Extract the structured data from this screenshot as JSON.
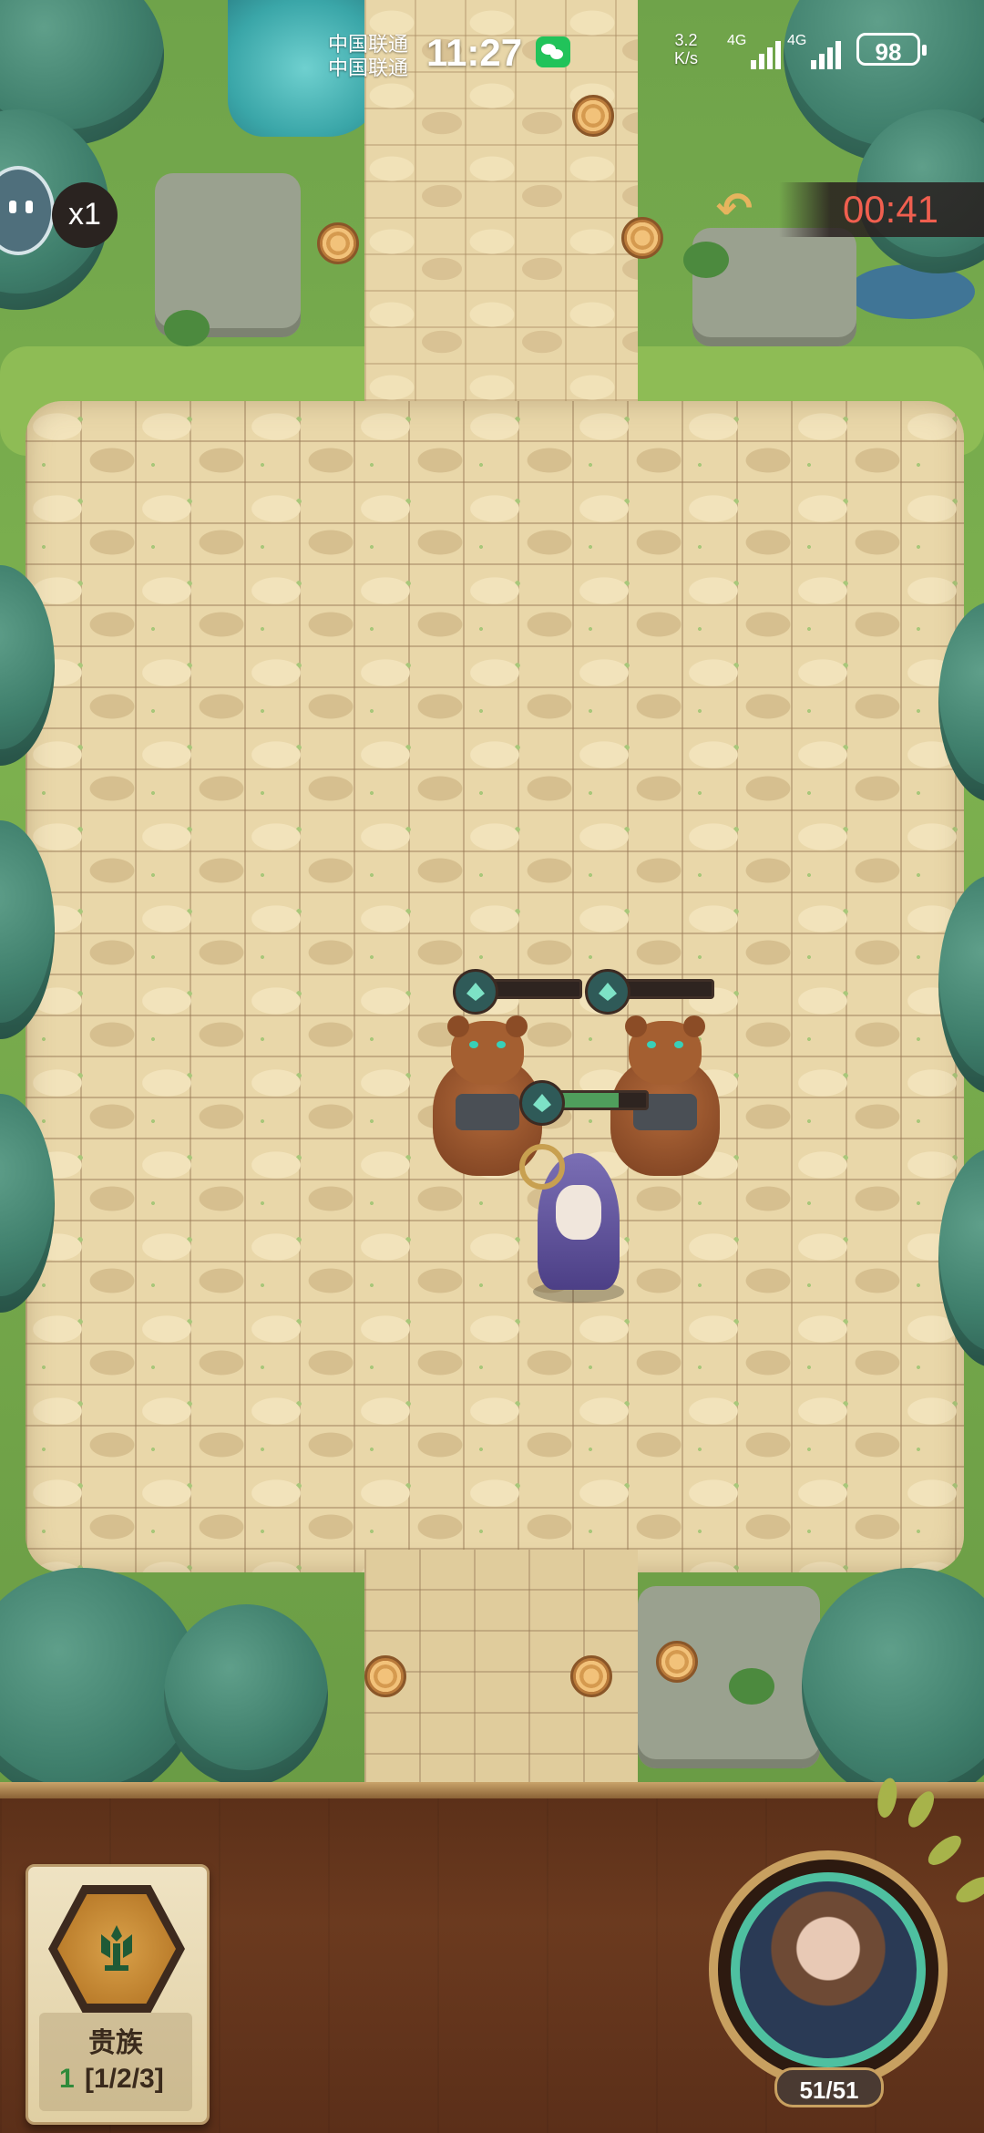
{
  "status_bar": {
    "carrier_1": "中国联通",
    "carrier_2": "中国联通",
    "time": "11:27",
    "net_speed_value": "3.2",
    "net_speed_unit": "K/s",
    "signal_1_label": "4G",
    "signal_2_label": "4G",
    "battery": "98"
  },
  "hud": {
    "speed_multiplier": "x1",
    "timer": "00:41",
    "back_icon": "undo-arrow-icon"
  },
  "units": {
    "bear_1_hp": 0.0,
    "bear_2_hp": 0.0,
    "wizard_hp": 0.7
  },
  "trait_card": {
    "name": "贵族",
    "active_count": "1",
    "tiers": "[1/2/3]",
    "icon": "noble-crest-icon"
  },
  "hero": {
    "hp_text": "51/51"
  },
  "colors": {
    "timer_red": "#f05f4f",
    "hp_green": "#4f9e5c",
    "trait_gold": "#d9a14a",
    "hero_ring": "#4ec0a0"
  }
}
